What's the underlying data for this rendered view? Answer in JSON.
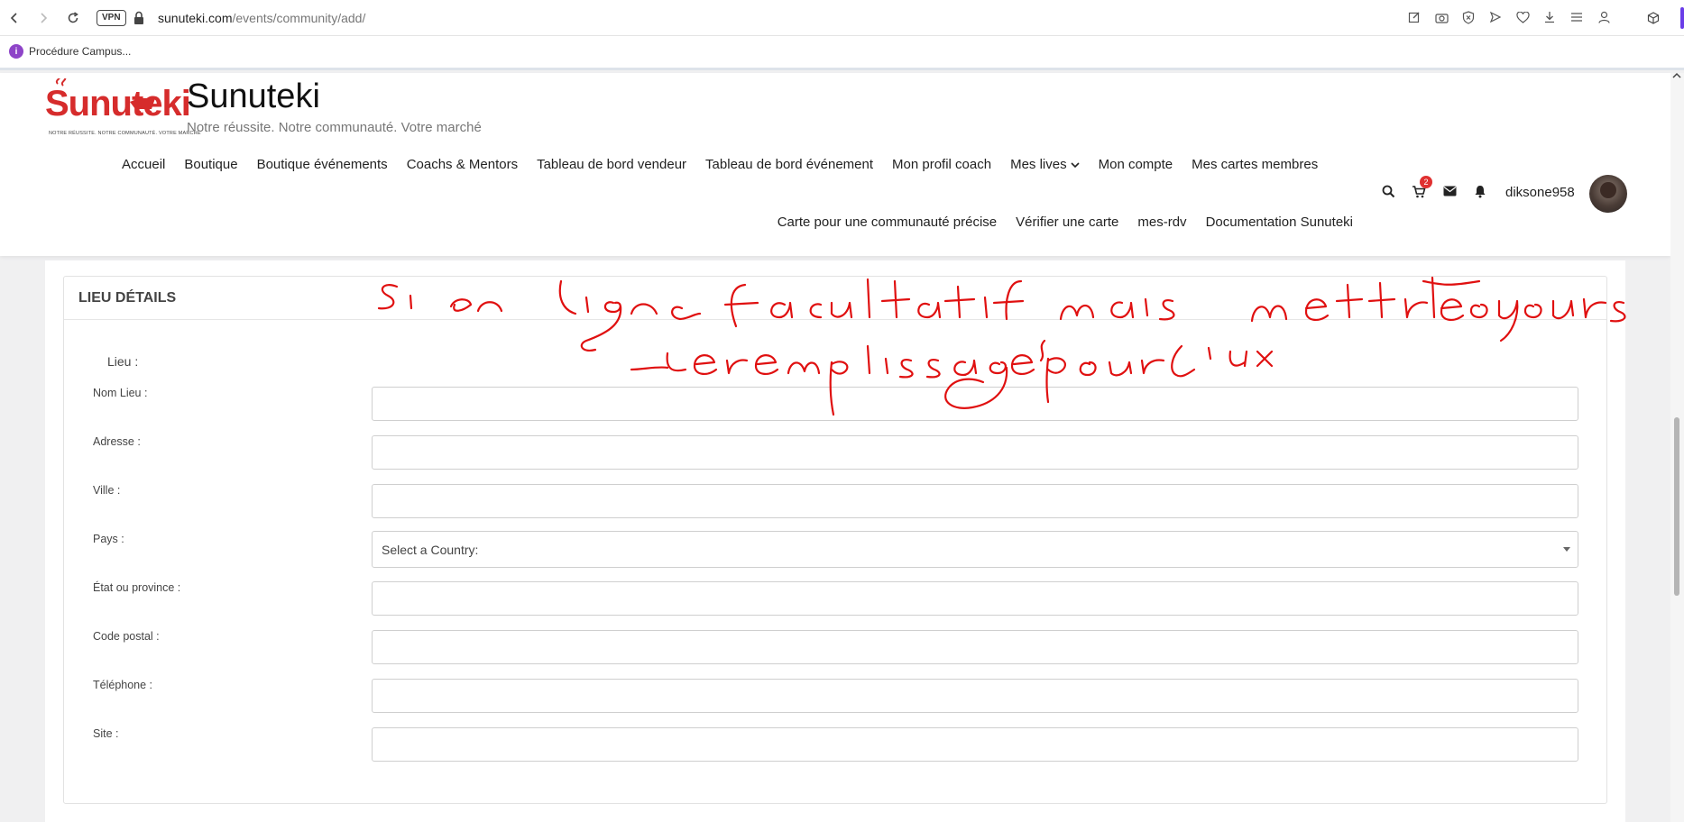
{
  "browser": {
    "vpn": "VPN",
    "url_host": "sunuteki.com",
    "url_path": "/events/community/add/",
    "bookmark": "Procédure Campus..."
  },
  "site": {
    "logo_text": "Sunuteki",
    "logo_tagline": "NOTRE RÉUSSITE. NOTRE COMMUNAUTÉ. VOTRE MARCHÉ",
    "title": "Sunuteki",
    "tagline": "Notre réussite. Notre communauté. Votre marché",
    "menu_row1": [
      "Accueil",
      "Boutique",
      "Boutique événements",
      "Coachs & Mentors",
      "Tableau de bord vendeur",
      "Tableau de bord événement",
      "Mon profil coach",
      "Mes lives",
      "Mon compte",
      "Mes cartes membres"
    ],
    "menu_row2": [
      "Carte pour une communauté précise",
      "Vérifier une carte",
      "mes-rdv",
      "Documentation Sunuteki"
    ],
    "cart_count": "2",
    "username": "diksone958"
  },
  "panel": {
    "title": "LIEU DÉTAILS",
    "section_label": "Lieu :",
    "fields": [
      {
        "label": "Nom Lieu :",
        "value": ""
      },
      {
        "label": "Adresse :",
        "value": ""
      },
      {
        "label": "Ville :",
        "value": ""
      },
      {
        "label": "Pays :",
        "value": "Select a Country:"
      },
      {
        "label": "État ou province :",
        "value": ""
      },
      {
        "label": "Code postal :",
        "value": ""
      },
      {
        "label": "Téléphone :",
        "value": ""
      },
      {
        "label": "Site :",
        "value": ""
      }
    ]
  },
  "annotation": {
    "line1": "si en ligne facultatif mais mettre toujours",
    "line2": "le remplissage pour l'UX",
    "color": "#e01010"
  },
  "colors": {
    "brand_red": "#d62c2c",
    "badge_red": "#e03030",
    "accent_purple": "#6a3de8"
  }
}
